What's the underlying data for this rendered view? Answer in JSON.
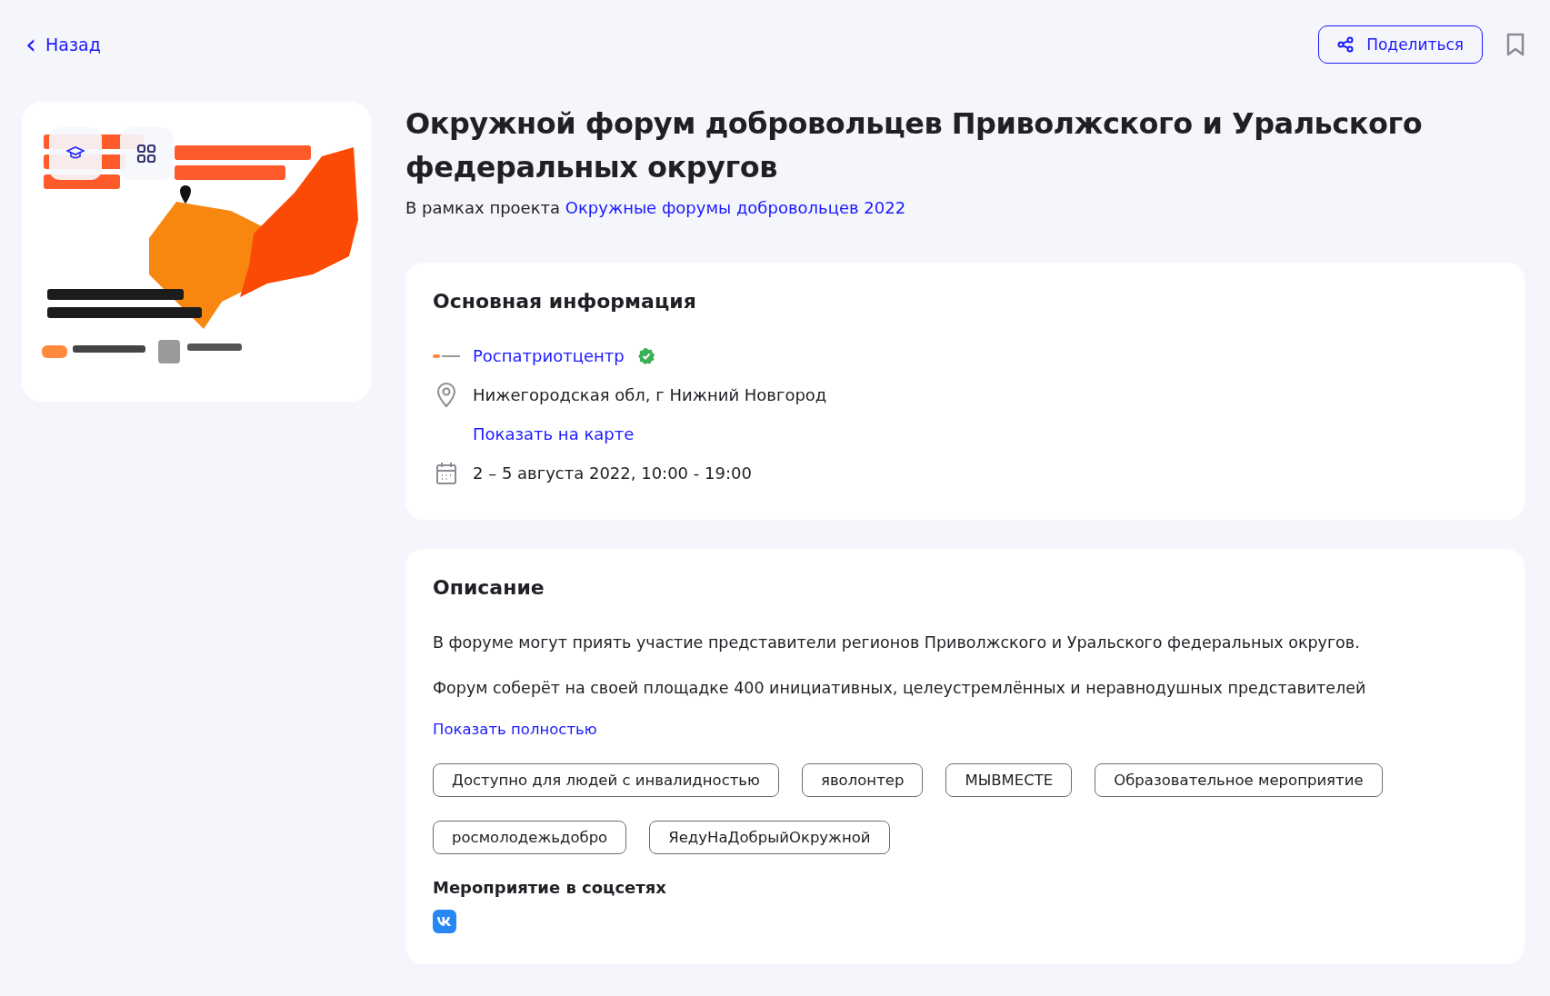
{
  "back": {
    "icon": "‹",
    "label": "Назад"
  },
  "share": {
    "label": "Поделиться"
  },
  "bookmark": {
    "saved": false
  },
  "title": "Окружной форум добровольцев Приволжского и Уральского федеральных округов",
  "project": {
    "prefix": "В рамках проекта",
    "link": "Окружные форумы добровольцев 2022"
  },
  "info": {
    "heading": "Основная информация",
    "organizer": "Роспатриотцентр",
    "verified": true,
    "address": "Нижегородская обл, г Нижний Новгород",
    "map_link": "Показать на карте",
    "dates": "2 – 5 августа 2022, 10:00 - 19:00"
  },
  "description": {
    "heading": "Описание",
    "paragraphs": [
      "В форуме могут приять участие представители регионов Приволжского и Уральского федеральных округов.",
      "Форум соберёт на своей площадке 400 инициативных, целеустремлённых и неравнодушных представителей"
    ],
    "more": "Показать полностью"
  },
  "tags": [
    "Доступно для людей с инвалидностью",
    "яволонтер",
    "МЫВМЕСТЕ",
    "Образовательное мероприятие",
    "росмолодежьдобро",
    "ЯедуНаДобрыйОкружной"
  ],
  "social": {
    "heading": "Мероприятие в соцсетях",
    "links": [
      {
        "kind": "vk"
      }
    ]
  }
}
